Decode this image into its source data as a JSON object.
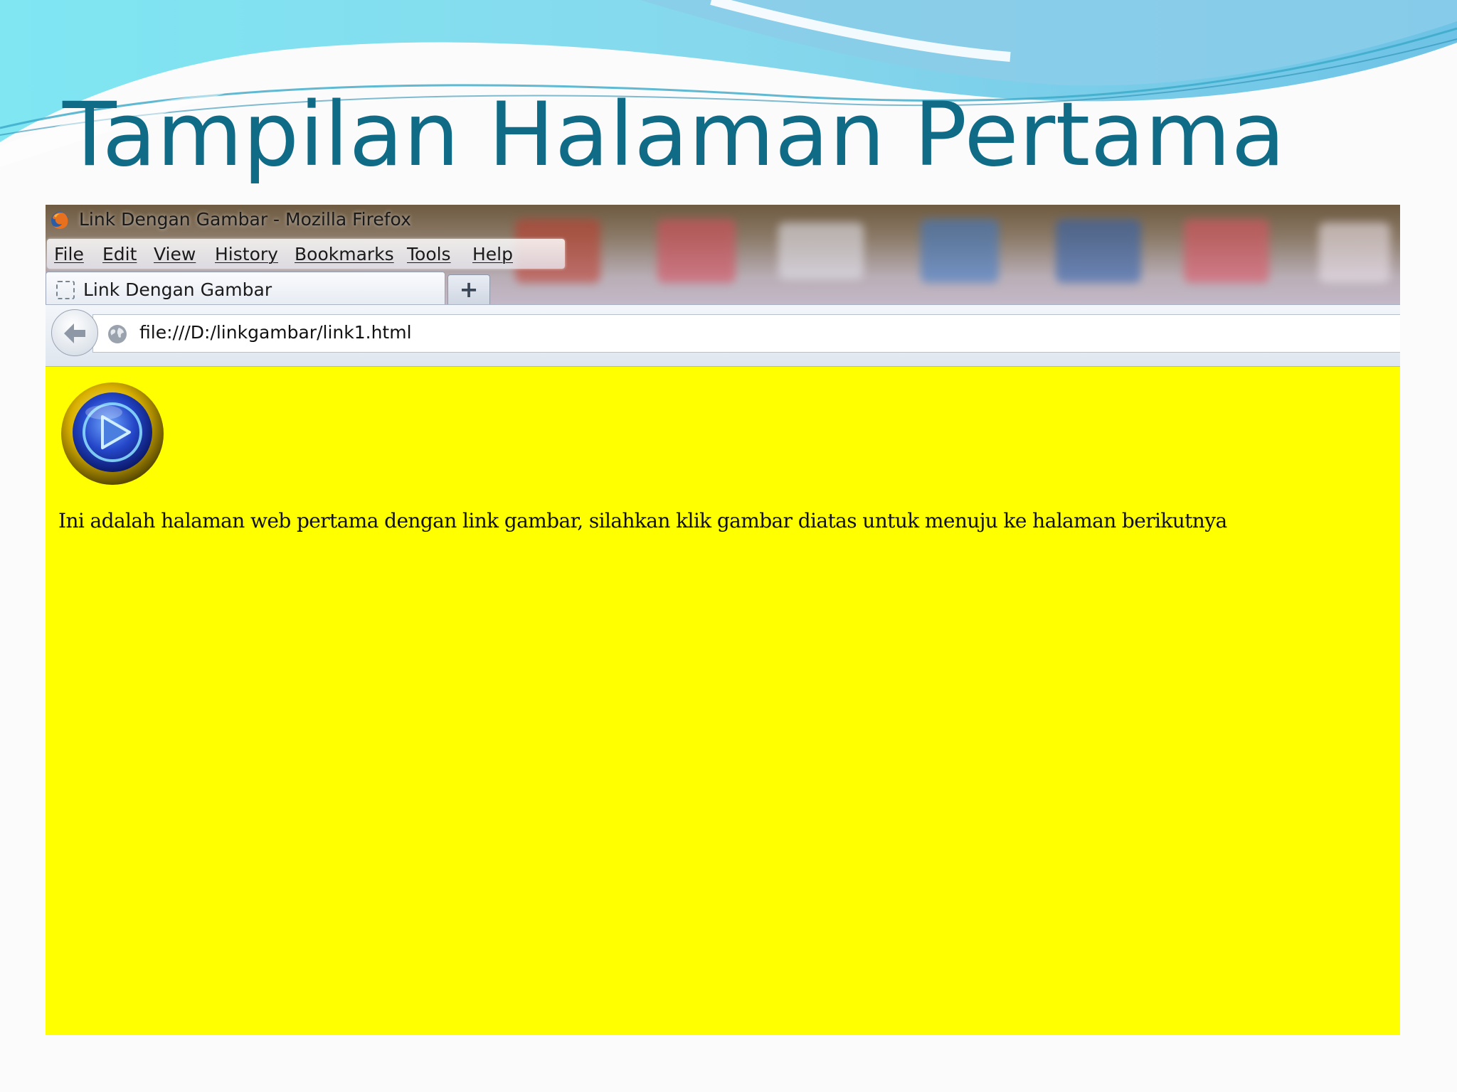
{
  "slide": {
    "title": "Tampilan Halaman Pertama",
    "title_color": "#0f6b86"
  },
  "browser": {
    "window_title": "Link Dengan Gambar - Mozilla Firefox",
    "menu": [
      "File",
      "Edit",
      "View",
      "History",
      "Bookmarks",
      "Tools",
      "Help"
    ],
    "tab_title": "Link Dengan Gambar",
    "new_tab_symbol": "+",
    "url": "file:///D:/linkgambar/link1.html",
    "icons": [
      "firefox-logo-icon",
      "blank-page-icon",
      "back-arrow-icon",
      "globe-icon",
      "play-button-icon"
    ]
  },
  "page": {
    "background": "#ffff00",
    "text": "Ini adalah halaman web pertama dengan link gambar, silahkan klik gambar diatas untuk menuju ke halaman berikutnya"
  }
}
